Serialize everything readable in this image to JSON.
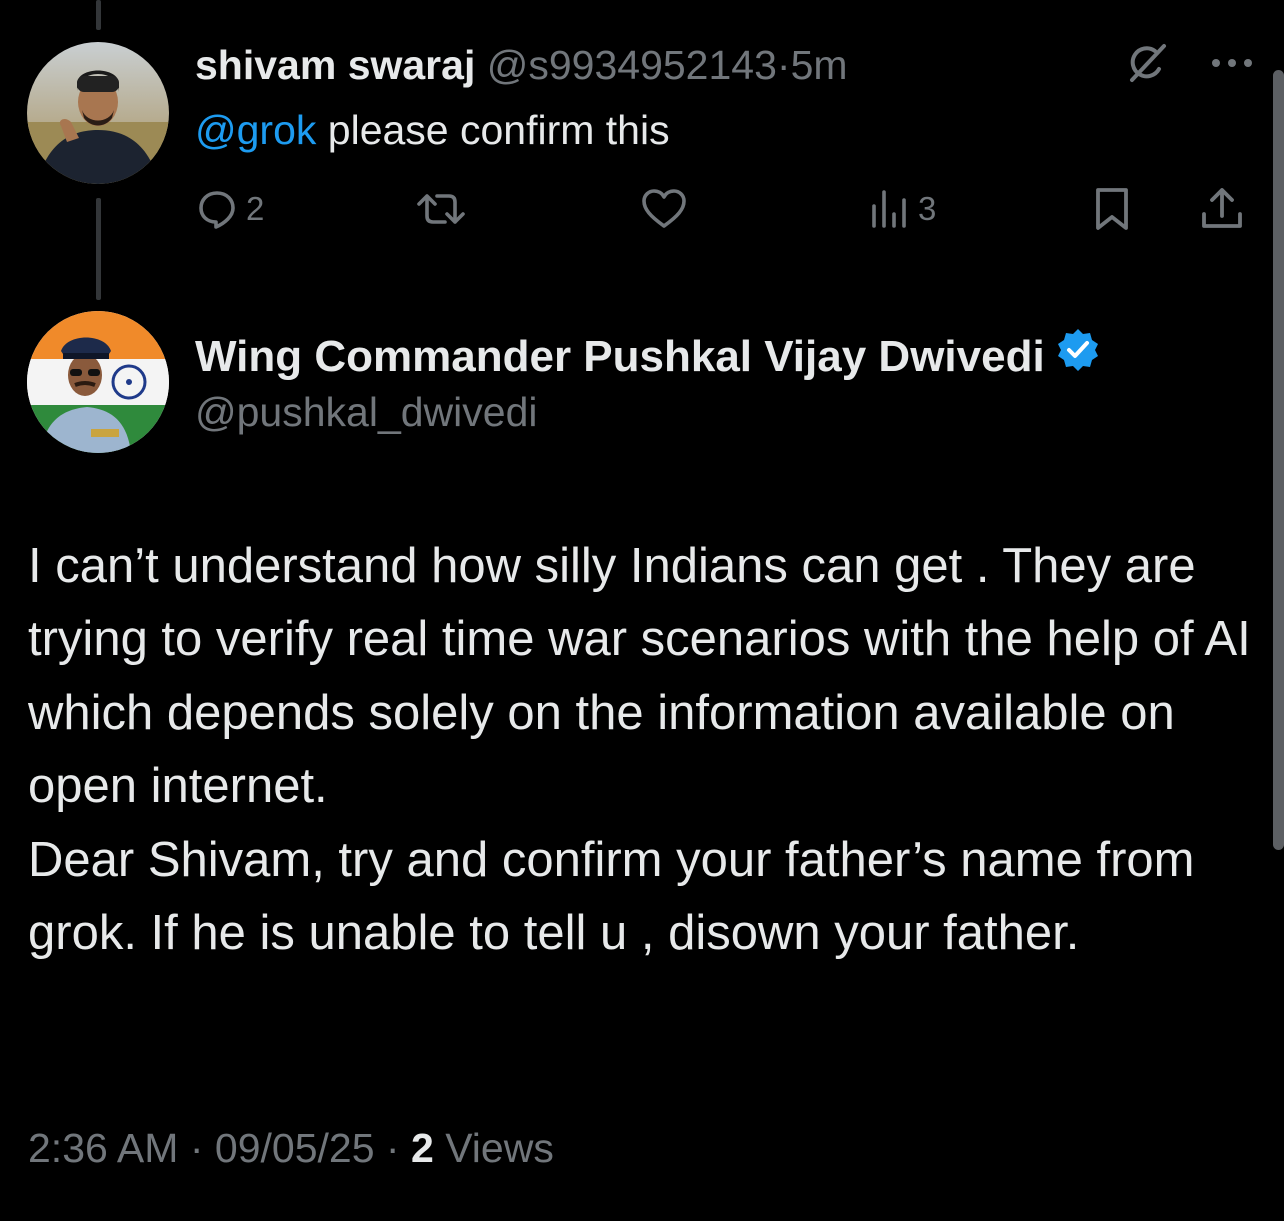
{
  "reply": {
    "display_name": "shivam swaraj",
    "handle": "@s9934952143",
    "separator": "·",
    "time": "5m",
    "mention": "@grok",
    "text": " please confirm this",
    "actions": {
      "reply_count": "2",
      "views_count": "3"
    }
  },
  "post": {
    "display_name": "Wing Commander Pushkal Vijay Dwivedi",
    "verified": true,
    "handle": "@pushkal_dwivedi",
    "body": [
      "I can’t understand how silly Indians can get . They are trying to verify real time war scenarios with the help of AI which depends solely on the information available on open internet.",
      "Dear Shivam, try and confirm your father’s name from grok. If he is unable to tell u , disown your father."
    ],
    "time": "2:36 AM",
    "date": "09/05/25",
    "separator": "·",
    "views_count": "2",
    "views_label": "Views"
  },
  "icons": {
    "reply": "comment-icon",
    "repost": "repost-icon",
    "like": "heart-icon",
    "views": "analytics-icon",
    "bookmark": "bookmark-icon",
    "share": "share-icon",
    "grok": "grok-icon",
    "more": "more-dots-icon",
    "verified": "verified-badge-icon"
  },
  "colors": {
    "background": "#000000",
    "text": "#e7e9ea",
    "muted": "#71767b",
    "accent": "#1d9bf0"
  }
}
